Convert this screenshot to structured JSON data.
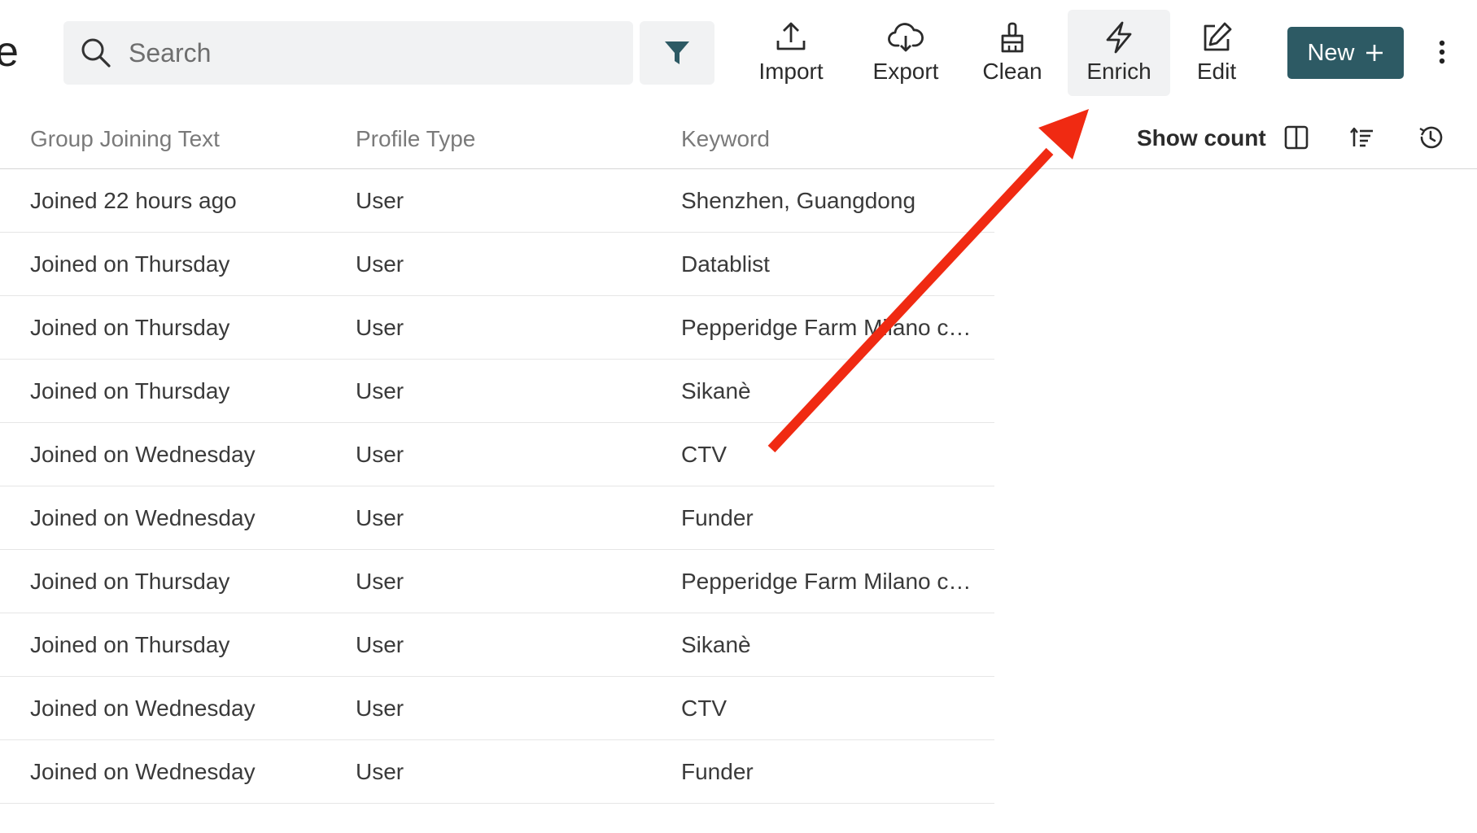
{
  "header": {
    "title_fragment": "e",
    "search": {
      "placeholder": "Search",
      "value": ""
    },
    "toolbar": [
      {
        "label": "Import",
        "icon": "upload-icon"
      },
      {
        "label": "Export",
        "icon": "cloud-download-icon"
      },
      {
        "label": "Clean",
        "icon": "brush-icon"
      },
      {
        "label": "Enrich",
        "icon": "lightning-icon"
      },
      {
        "label": "Edit",
        "icon": "edit-icon"
      }
    ],
    "new_button": {
      "label": "New",
      "icon": "plus-icon"
    }
  },
  "table": {
    "columns": [
      "Group Joining Text",
      "Profile Type",
      "Keyword"
    ],
    "show_count": "Show count",
    "rows": [
      [
        "Joined 22 hours ago",
        "User",
        "Shenzhen, Guangdong"
      ],
      [
        "Joined on Thursday",
        "User",
        "Datablist"
      ],
      [
        "Joined on Thursday",
        "User",
        "Pepperidge Farm Milano co…"
      ],
      [
        "Joined on Thursday",
        "User",
        "Sikanè"
      ],
      [
        "Joined on Wednesday",
        "User",
        "CTV"
      ],
      [
        "Joined on Wednesday",
        "User",
        "Funder"
      ],
      [
        "Joined on Thursday",
        "User",
        "Pepperidge Farm Milano co…"
      ],
      [
        "Joined on Thursday",
        "User",
        "Sikanè"
      ],
      [
        "Joined on Wednesday",
        "User",
        "CTV"
      ],
      [
        "Joined on Wednesday",
        "User",
        "Funder"
      ]
    ]
  },
  "colors": {
    "accent": "#2d5a64",
    "annotation_arrow": "#f02a12"
  }
}
